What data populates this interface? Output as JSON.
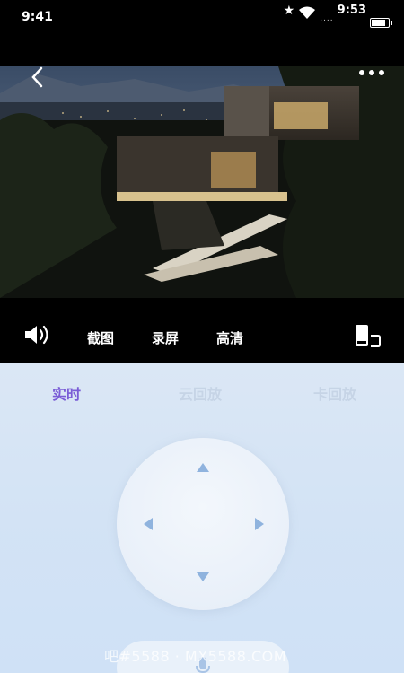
{
  "status_bar": {
    "time": "9:41",
    "clock": "9:53",
    "signal_dots": "....",
    "icons": [
      "star-icon",
      "wifi-icon",
      "battery-icon"
    ]
  },
  "video": {
    "scene": "modern-house-night-photo",
    "back_icon": "chevron-left-icon",
    "more_icon": "more-dots-icon"
  },
  "controls": {
    "volume_icon": "speaker-icon",
    "screenshot_label": "截图",
    "record_label": "录屏",
    "hd_label": "高清",
    "rotate_icon": "fullscreen-rotate-icon"
  },
  "tabs": [
    {
      "label": "实时",
      "active": true
    },
    {
      "label": "云回放",
      "active": false
    },
    {
      "label": "卡回放",
      "active": false
    }
  ],
  "joystick": {
    "arrows": [
      "up-arrow-icon",
      "down-arrow-icon",
      "left-arrow-icon",
      "right-arrow-icon"
    ]
  },
  "mic": {
    "icon": "microphone-icon"
  },
  "watermark": "吧#5588 · MX5588.COM",
  "colors": {
    "active_tab": "#7a5cd6",
    "inactive_tab": "#c6d4e6",
    "panel_bg": "#d3e3f5",
    "arrow": "#8fb3de"
  }
}
